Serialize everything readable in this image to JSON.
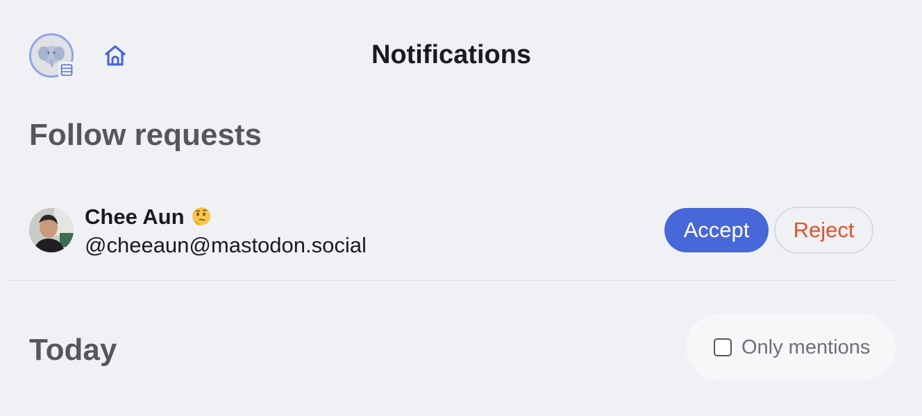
{
  "header": {
    "title": "Notifications",
    "account_avatar_icon": "elephant-avatar-icon",
    "account_badge_icon": "list-icon",
    "home_icon": "home-icon",
    "accent_color": "#4867d8"
  },
  "follow_requests": {
    "heading": "Follow requests",
    "items": [
      {
        "name": "Chee Aun",
        "emoji_icon": "thinking-face-icon",
        "handle": "@cheeaun@mastodon.social",
        "accept_label": "Accept",
        "reject_label": "Reject"
      }
    ]
  },
  "today": {
    "heading": "Today",
    "filter_label": "Only mentions",
    "filter_checked": false
  },
  "colors": {
    "background": "#f0f1f5",
    "accept": "#4867d8",
    "reject_text": "#e0532a",
    "heading": "#56575c"
  }
}
